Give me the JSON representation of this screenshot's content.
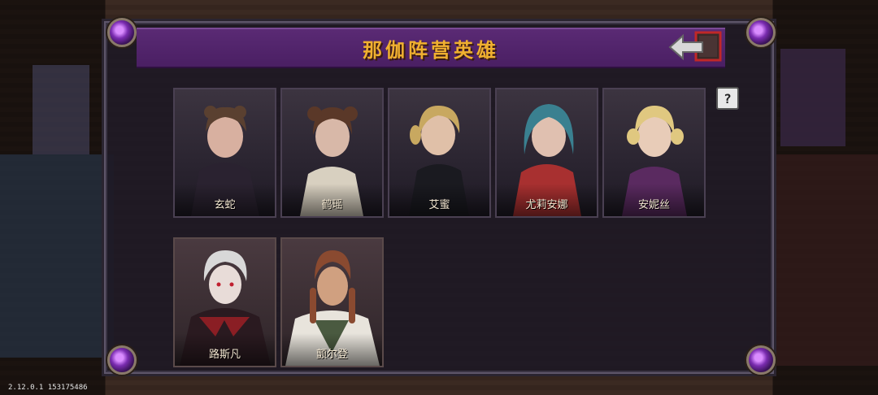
{
  "window": {
    "title": "那伽阵营英雄"
  },
  "heroes": [
    {
      "name": "玄蛇",
      "hair": "#5a4030",
      "skin": "#d8b0a0",
      "outfit": "#2a2230"
    },
    {
      "name": "鹤瑶",
      "hair": "#5a3828",
      "skin": "#d8b8a8",
      "outfit": "#d8d0c0"
    },
    {
      "name": "艾蜜",
      "hair": "#c8a860",
      "skin": "#e0c0a8",
      "outfit": "#1a1a20"
    },
    {
      "name": "尤莉安娜",
      "hair": "#3a8090",
      "skin": "#e0c0b0",
      "outfit": "#a83030"
    },
    {
      "name": "安妮丝",
      "hair": "#e0c880",
      "skin": "#e8ccb8",
      "outfit": "#5a2a60"
    },
    {
      "name": "路斯凡",
      "hair": "#d8d8d8",
      "skin": "#e8dcd8",
      "outfit": "#2a1a20"
    },
    {
      "name": "颤尔登",
      "hair": "#8a4a30",
      "skin": "#d0a080",
      "outfit": "#e8e4dc"
    }
  ],
  "buttons": {
    "back": "back-arrow-icon",
    "help": "?"
  },
  "footer": {
    "version": "2.12.0.1 153175486"
  },
  "colors": {
    "title": "#f0b030",
    "title_bar": "#5a2a74",
    "gem": "#9b3fd0"
  }
}
